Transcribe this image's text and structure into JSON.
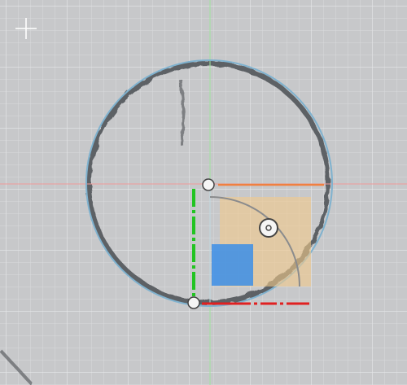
{
  "viewport": {
    "background": "#c7c8ca",
    "grid_minor_color": "#d9dadc",
    "grid_major_color": "#e6e7e9",
    "vertical_guide_color": "#9fe39f",
    "horizontal_guide_color": "#ef9a9a",
    "texture_ring_color": "#4b4f54",
    "primitive_outline_color": "#7fb2cf",
    "icons": {
      "add_cursor": "plus-cursor-icon",
      "move_handle": "circle-handle-icon",
      "angle_handle": "dot-in-circle-icon"
    }
  },
  "gizmo": {
    "rotation_arc_color": "#8a8b8d",
    "x_axis_color": "#e02020",
    "y_axis_color": "#22c422",
    "z_axis_color": "#f08040",
    "plane_xz_color": "#f2c98a",
    "plane_xy_color": "#3b8ee8",
    "handle_fill": "#f5f5f5",
    "handle_stroke": "#444444"
  }
}
